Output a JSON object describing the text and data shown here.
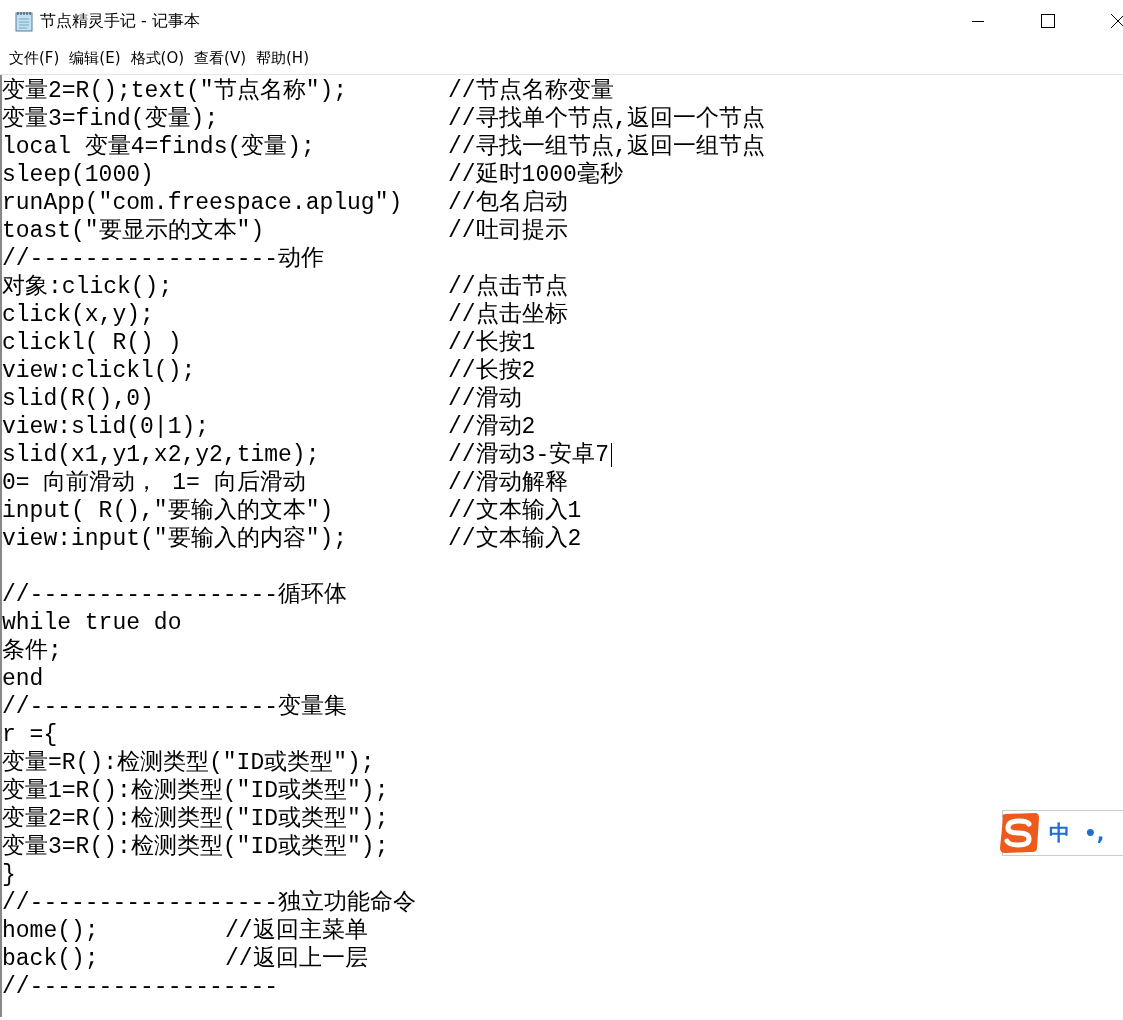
{
  "window": {
    "title": "节点精灵手记 - 记事本"
  },
  "menu": [
    {
      "label": "文件(F)"
    },
    {
      "label": "编辑(E)"
    },
    {
      "label": "格式(O)"
    },
    {
      "label": "查看(V)"
    },
    {
      "label": "帮助(H)"
    }
  ],
  "lines": [
    {
      "kind": "pair",
      "code": "变量2=R();text(\"节点名称\");",
      "comment": "//节点名称变量"
    },
    {
      "kind": "pair",
      "code": "变量3=find(变量);",
      "comment": "//寻找单个节点,返回一个节点"
    },
    {
      "kind": "pair",
      "code": "local 变量4=finds(变量);",
      "comment": "//寻找一组节点,返回一组节点"
    },
    {
      "kind": "pair",
      "code": "sleep(1000)",
      "comment": "//延时1000毫秒"
    },
    {
      "kind": "pair",
      "code": "runApp(\"com.freespace.aplug\")",
      "comment": "//包名启动"
    },
    {
      "kind": "pair",
      "code": "toast(\"要显示的文本\")",
      "comment": "//吐司提示"
    },
    {
      "kind": "plain",
      "code": "//------------------动作"
    },
    {
      "kind": "pair",
      "code": "对象:click();",
      "comment": "//点击节点"
    },
    {
      "kind": "pair",
      "code": "click(x,y);",
      "comment": "//点击坐标"
    },
    {
      "kind": "pair",
      "code": "clickl( R() )",
      "comment": "//长按1"
    },
    {
      "kind": "pair",
      "code": "view:clickl();",
      "comment": "//长按2"
    },
    {
      "kind": "pair",
      "code": "slid(R(),0)",
      "comment": "//滑动"
    },
    {
      "kind": "pair",
      "code": "view:slid(0|1);",
      "comment": "//滑动2"
    },
    {
      "kind": "pair",
      "code": "slid(x1,y1,x2,y2,time);",
      "comment": "//滑动3-安卓7",
      "cursor": true
    },
    {
      "kind": "pair",
      "code": "0= 向前滑动， 1= 向后滑动",
      "comment": "//滑动解释"
    },
    {
      "kind": "pair",
      "code": "input( R(),\"要输入的文本\")",
      "comment": "//文本输入1"
    },
    {
      "kind": "pair",
      "code": "view:input(\"要输入的内容\");",
      "comment": "//文本输入2"
    },
    {
      "kind": "blank"
    },
    {
      "kind": "plain",
      "code": "//------------------循环体"
    },
    {
      "kind": "plain",
      "code": "while true do"
    },
    {
      "kind": "plain",
      "code": "条件;"
    },
    {
      "kind": "plain",
      "code": "end"
    },
    {
      "kind": "plain",
      "code": "//------------------变量集"
    },
    {
      "kind": "plain",
      "code": "r ={"
    },
    {
      "kind": "plain",
      "code": "变量=R():检测类型(\"ID或类型\");"
    },
    {
      "kind": "plain",
      "code": "变量1=R():检测类型(\"ID或类型\");"
    },
    {
      "kind": "plain",
      "code": "变量2=R():检测类型(\"ID或类型\");"
    },
    {
      "kind": "plain",
      "code": "变量3=R():检测类型(\"ID或类型\");"
    },
    {
      "kind": "plain",
      "code": "}"
    },
    {
      "kind": "plain",
      "code": "//------------------独立功能命令"
    },
    {
      "kind": "short",
      "code": "home();",
      "comment": "//返回主菜单"
    },
    {
      "kind": "short",
      "code": "back();",
      "comment": "//返回上一层"
    },
    {
      "kind": "plain",
      "code": "//------------------"
    }
  ],
  "ime": {
    "mode": "中",
    "punctuation": "•,"
  }
}
